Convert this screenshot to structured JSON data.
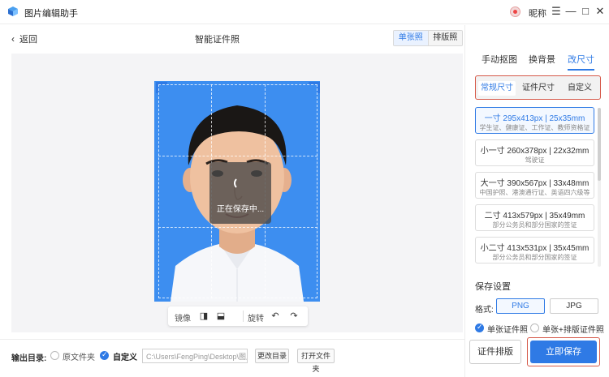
{
  "app": {
    "title": "图片编辑助手",
    "user_name": "昵称"
  },
  "window": {
    "menu": "☰",
    "minimize": "—",
    "maximize": "□",
    "close": "✕"
  },
  "workbar": {
    "back": "返回",
    "title": "智能证件照",
    "modes": [
      "单张照",
      "排版照"
    ],
    "active_mode": "单张照"
  },
  "canvas": {
    "saving_text": "正在保存中..."
  },
  "toolbar": {
    "mirror": "镜像",
    "rotate": "旋转"
  },
  "bottom": {
    "output_label": "输出目录:",
    "opt_original": "原文件夹",
    "opt_custom": "自定义",
    "path": "C:\\Users\\FengPing\\Desktop\\图片",
    "change_dir": "更改目录",
    "open_folder": "打开文件夹"
  },
  "panel": {
    "tabs": [
      "手动抠图",
      "换背景",
      "改尺寸"
    ],
    "active_tab": "改尺寸",
    "sub_tabs": [
      "常规尺寸",
      "证件尺寸",
      "自定义"
    ],
    "active_sub_tab": "常规尺寸",
    "sizes": [
      {
        "title": "一寸 295x413px | 25x35mm",
        "desc": "学生证、健康证、工作证、教师资格证"
      },
      {
        "title": "小一寸 260x378px | 22x32mm",
        "desc": "驾驶证"
      },
      {
        "title": "大一寸 390x567px | 33x48mm",
        "desc": "中国护照、港澳通行证、英语四六级等"
      },
      {
        "title": "二寸 413x579px | 35x49mm",
        "desc": "部分公务员和部分国家的签证"
      },
      {
        "title": "小二寸 413x531px | 35x45mm",
        "desc": "部分公务员和部分国家的签证"
      }
    ],
    "save_settings": "保存设置",
    "format_label": "格式:",
    "formats": [
      "PNG",
      "JPG"
    ],
    "active_format": "PNG",
    "save_opt1": "单张证件照",
    "save_opt2": "单张+排版证件照",
    "print_layout": "证件排版",
    "save_now": "立即保存"
  },
  "colors": {
    "accent": "#2f7ae5",
    "photo_bg": "#3d8ef0",
    "highlight": "#d65a4a"
  }
}
